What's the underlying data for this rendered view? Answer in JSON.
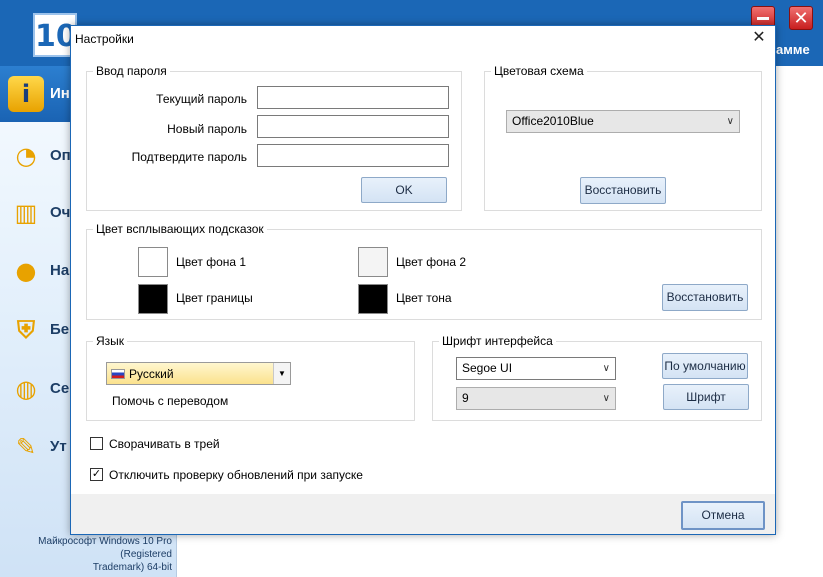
{
  "background_app": {
    "logo_text": "10",
    "header_right_text": "амме",
    "sidebar_items": [
      {
        "label": "Ин",
        "icon": "info-icon"
      },
      {
        "label": "Оп",
        "icon": "gauge-icon"
      },
      {
        "label": "Оч",
        "icon": "trash-icon"
      },
      {
        "label": "На",
        "icon": "user-icon"
      },
      {
        "label": "Бе",
        "icon": "shield-icon"
      },
      {
        "label": "Се",
        "icon": "globe-icon"
      },
      {
        "label": "Ут",
        "icon": "wrench-icon"
      }
    ],
    "status_line1": "Майкрософт Windows 10 Pro (Registered",
    "status_line2": "Trademark) 64-bit"
  },
  "dialog": {
    "title": "Настройки",
    "close_glyph": "✕",
    "password_group": {
      "legend": "Ввод пароля",
      "current_label": "Текущий пароль",
      "new_label": "Новый пароль",
      "confirm_label": "Подтвердите пароль",
      "current_value": "",
      "new_value": "",
      "confirm_value": "",
      "ok_label": "OK"
    },
    "color_scheme_group": {
      "legend": "Цветовая схема",
      "selected": "Office2010Blue",
      "restore_label": "Восстановить"
    },
    "tooltip_colors_group": {
      "legend": "Цвет всплывающих подсказок",
      "bg1_label": "Цвет фона 1",
      "bg2_label": "Цвет фона 2",
      "border_label": "Цвет границы",
      "tone_label": "Цвет тона",
      "bg1_color": "#ffffff",
      "bg2_color": "#f4f4f4",
      "border_color": "#000000",
      "tone_color": "#000000",
      "restore_label": "Восстановить"
    },
    "language_group": {
      "legend": "Язык",
      "selected": "Русский",
      "help_translate": "Помочь с переводом"
    },
    "font_group": {
      "legend": "Шрифт интерфейса",
      "font_name": "Segoe UI",
      "font_size": "9",
      "default_label": "По умолчанию",
      "font_label": "Шрифт"
    },
    "minimize_to_tray": {
      "label": "Сворачивать в трей",
      "checked": false
    },
    "disable_update_check": {
      "label": "Отключить проверку обновлений при запуске",
      "checked": true
    },
    "cancel_label": "Отмена"
  }
}
